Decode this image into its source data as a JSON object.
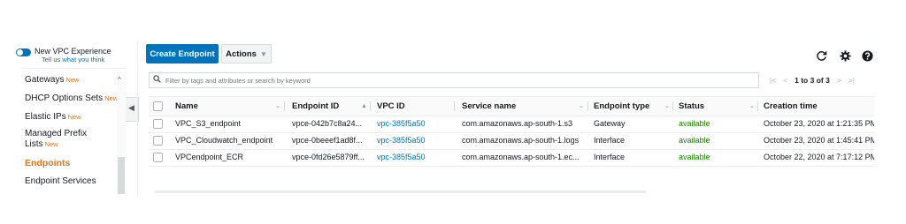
{
  "sidebar": {
    "new_experience_title": "New VPC Experience",
    "new_experience_subtitle": "Tell us what you think",
    "new_badge": "New",
    "items": [
      {
        "label": "Gateways",
        "badge": "New"
      },
      {
        "label": "DHCP Options Sets",
        "badge": "New"
      },
      {
        "label": "Elastic IPs",
        "badge": "New"
      },
      {
        "label": "Managed Prefix Lists",
        "badge": "New"
      },
      {
        "label": "Endpoints",
        "badge": ""
      },
      {
        "label": "Endpoint Services",
        "badge": ""
      }
    ],
    "active_item": "Endpoints"
  },
  "toolbar": {
    "create_label": "Create Endpoint",
    "actions_label": "Actions"
  },
  "filter": {
    "placeholder": "Filter by tags and attributes or search by keyword"
  },
  "pagination": {
    "info": "1 to 3 of 3"
  },
  "table": {
    "columns": [
      "Name",
      "Endpoint ID",
      "VPC ID",
      "Service name",
      "Endpoint type",
      "Status",
      "Creation time"
    ],
    "rows": [
      {
        "name": "VPC_S3_endpoint",
        "endpoint_id": "vpce-042b7c8a24...",
        "vpc_id": "vpc-385f5a50",
        "service": "com.amazonaws.ap-south-1.s3",
        "type": "Gateway",
        "status": "available",
        "created": "October 23, 2020 at 1:21:35 PM"
      },
      {
        "name": "VPC_Cloudwatch_endpoint",
        "endpoint_id": "vpce-0beeef1ad8f...",
        "vpc_id": "vpc-385f5a50",
        "service": "com.amazonaws.ap-south-1.logs",
        "type": "Interface",
        "status": "available",
        "created": "October 23, 2020 at 1:45:41 PM"
      },
      {
        "name": "VPCendpoint_ECR",
        "endpoint_id": "vpce-0fd26e5879ff...",
        "vpc_id": "vpc-385f5a50",
        "service": "com.amazonaws.ap-south-1.ec...",
        "type": "Interface",
        "status": "available",
        "created": "October 22, 2020 at 7:17:12 PM"
      }
    ]
  },
  "colors": {
    "accent": "#0073bb",
    "active_nav": "#ec7211",
    "status_available": "#1d8102"
  }
}
